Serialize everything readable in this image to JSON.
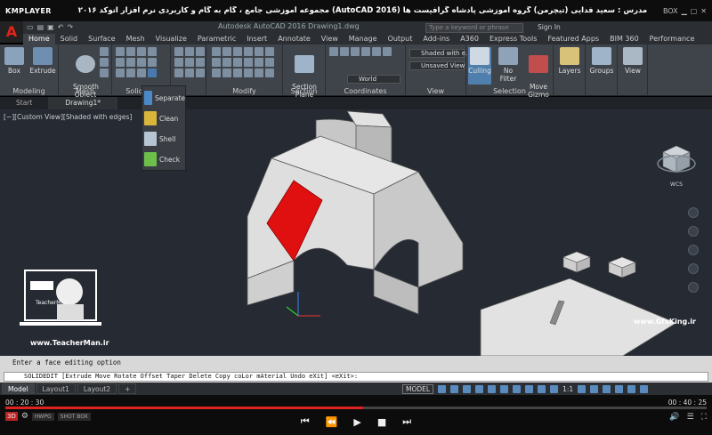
{
  "player": {
    "logo": "KMPLAYER",
    "title": "مجموعه آموزشی جامع ، گام به گام و کاربردی نرم افزار اتوکد ۲۰۱۶ (AutoCAD 2016) مدرس : سعید فدایی (تیچرمن) گروه آموزشی پادشاه گرافیست ها",
    "box_label": "BOX",
    "time_current": "00 : 20 : 30",
    "time_total": "00 : 40 : 25",
    "progress": 0.51,
    "badge": "3D",
    "chip1": "HWPG",
    "chip2": "SHOT BOX"
  },
  "app": {
    "logo_letter": "A",
    "doc_title": "Autodesk AutoCAD 2016  Drawing1.dwg",
    "search_placeholder": "Type a keyword or phrase",
    "sign_in": "Sign In"
  },
  "ribbon_tabs": [
    "Home",
    "Solid",
    "Surface",
    "Mesh",
    "Visualize",
    "Parametric",
    "Insert",
    "Annotate",
    "View",
    "Manage",
    "Output",
    "Add-ins",
    "A360",
    "Express Tools",
    "Featured Apps",
    "BIM 360",
    "Performance"
  ],
  "ribbon": {
    "box": "Box",
    "extrude": "Extrude",
    "smooth_object": "Smooth\nObject",
    "section_plane": "Section\nPlane",
    "culling": "Culling",
    "no_filter": "No Filter",
    "move_gizmo": "Move\nGizmo",
    "layers": "Layers",
    "groups": "Groups",
    "view": "View",
    "visual_style": "Shaded with e...",
    "view_name": "Unsaved View",
    "ucs": "World",
    "panels": {
      "modeling": "Modeling",
      "mesh": "Mesh",
      "solid_editing": "Solid Edi",
      "modify": "Modify",
      "section": "Section",
      "coordinates": "Coordinates",
      "view": "View",
      "selection": "Selection"
    }
  },
  "flyout": {
    "separate": "Separate",
    "clean": "Clean",
    "shell": "Shell",
    "check": "Check"
  },
  "file_tabs": [
    "Start",
    "Drawing1*"
  ],
  "viewport": {
    "label": "[−][Custom View][Shaded with edges]",
    "wcs": "WCS"
  },
  "command": {
    "history": "Enter a face editing option",
    "prompt": "SOLIDEDIT [Extrude Move Rotate Offset Taper Delete Copy coLor mAterial Undo eXit] <eXit>:"
  },
  "layout_tabs": [
    "Model",
    "Layout1",
    "Layout2"
  ],
  "status": {
    "model": "MODEL",
    "scale": "1:1"
  },
  "watermarks": {
    "teacher_site": "www.TeacherMan.ir",
    "gfx": "www.GfxKing.ir",
    "teacher_caption": "TeacherMan"
  },
  "colors": {
    "selected_face": "#e01010",
    "solid_face": "#d9d9d9",
    "viewport_bg": "#252a33",
    "progress": "#dd2222"
  }
}
